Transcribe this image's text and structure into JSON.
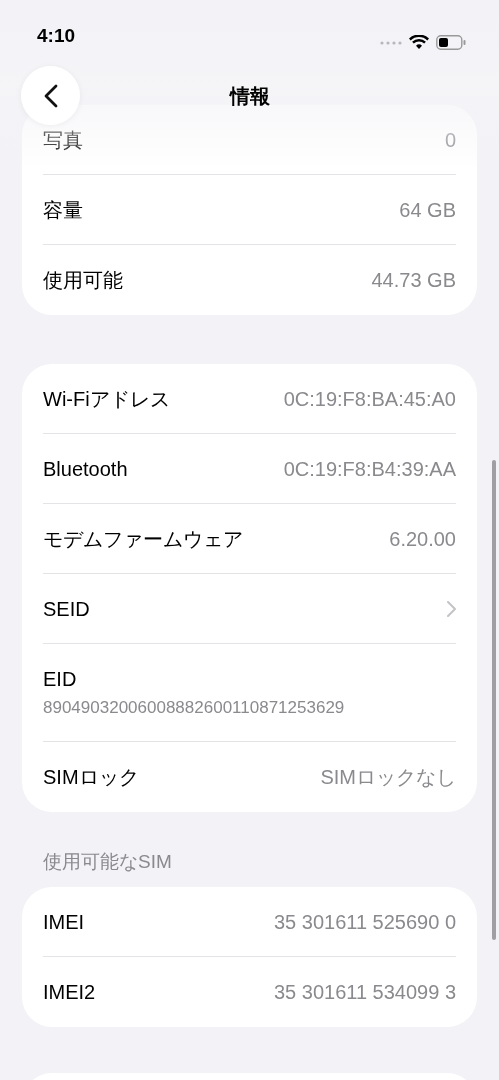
{
  "status_bar": {
    "time": "4:10"
  },
  "nav": {
    "title": "情報"
  },
  "sections": [
    {
      "rows": [
        {
          "kind": "value",
          "label": "写真",
          "value": "0"
        },
        {
          "kind": "value",
          "label": "容量",
          "value": "64 GB"
        },
        {
          "kind": "value",
          "label": "使用可能",
          "value": "44.73 GB"
        }
      ]
    },
    {
      "rows": [
        {
          "kind": "value",
          "label": "Wi-Fiアドレス",
          "value": "0C:19:F8:BA:45:A0"
        },
        {
          "kind": "value",
          "label": "Bluetooth",
          "value": "0C:19:F8:B4:39:AA"
        },
        {
          "kind": "value",
          "label": "モデムファームウェア",
          "value": "6.20.00"
        },
        {
          "kind": "link",
          "label": "SEID"
        },
        {
          "kind": "stacked",
          "label": "EID",
          "value": "89049032006008882600110871253629"
        },
        {
          "kind": "value",
          "label": "SIMロック",
          "value": "SIMロックなし"
        }
      ]
    },
    {
      "header": "使用可能なSIM",
      "rows": [
        {
          "kind": "value",
          "label": "IMEI",
          "value": "35 301611 525690 0"
        },
        {
          "kind": "value",
          "label": "IMEI2",
          "value": "35 301611 534099 3"
        }
      ]
    }
  ]
}
